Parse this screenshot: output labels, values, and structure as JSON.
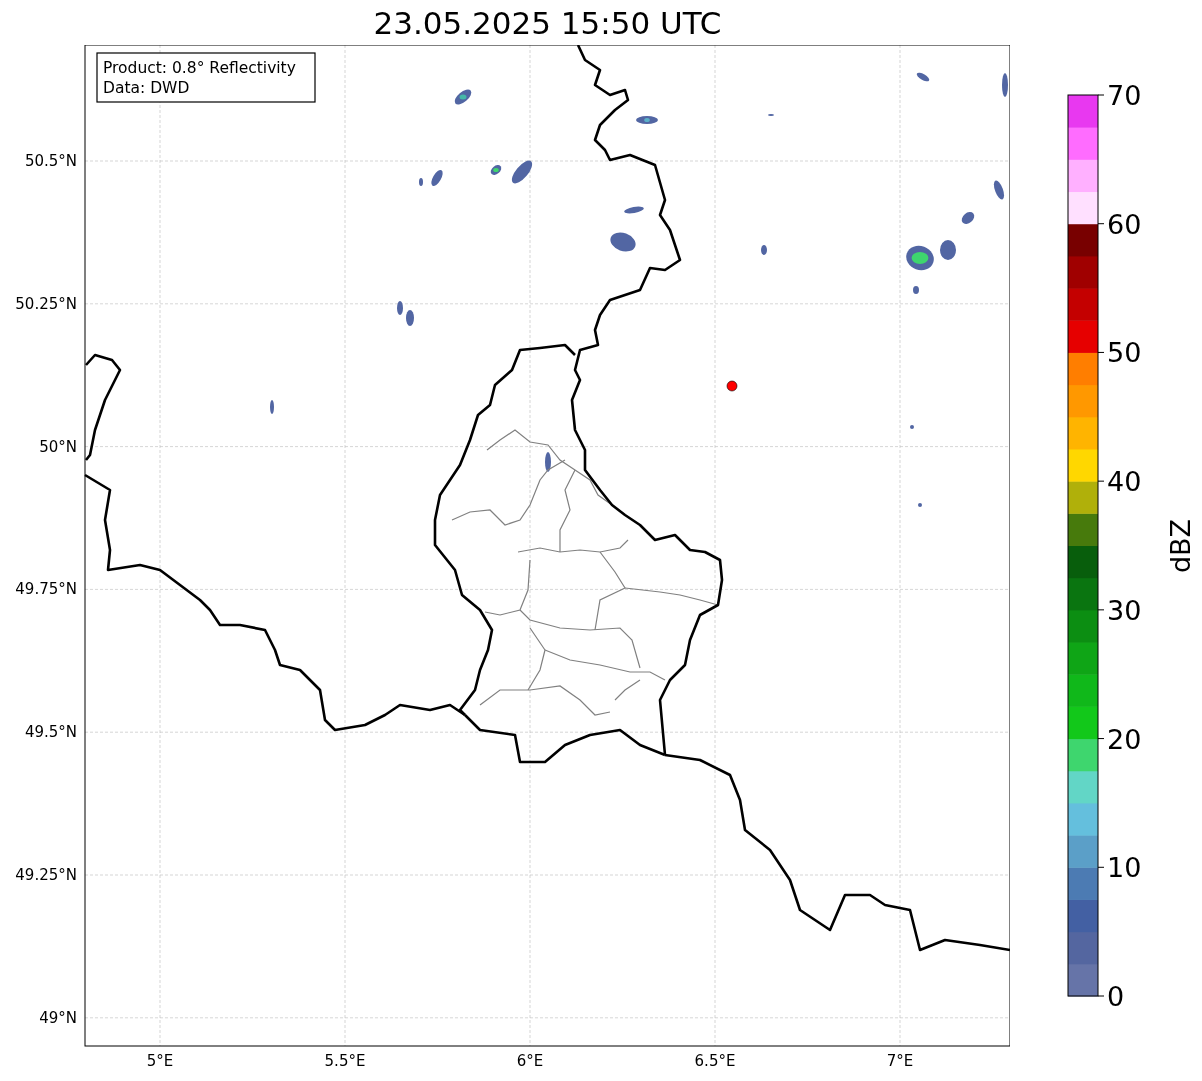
{
  "title": "23.05.2025 15:50 UTC",
  "info_box": [
    "Product: 0.8° Reflectivity",
    "Data: DWD"
  ],
  "map": {
    "x_ticks": [
      "5°E",
      "5.5°E",
      "6°E",
      "6.5°E",
      "7°E"
    ],
    "y_ticks": [
      "50.5°N",
      "50.25°N",
      "50°N",
      "49.75°N",
      "49.5°N",
      "49.25°N",
      "49°N"
    ]
  },
  "colorbar": {
    "label": "dBZ",
    "ticks": [
      "70",
      "60",
      "50",
      "40",
      "30",
      "20",
      "10",
      "0"
    ],
    "levels": [
      {
        "color": "#6674a8"
      },
      {
        "color": "#5466a0"
      },
      {
        "color": "#4360a3"
      },
      {
        "color": "#4c7bb3"
      },
      {
        "color": "#5b9fc8"
      },
      {
        "color": "#64bfdd"
      },
      {
        "color": "#62d6c6"
      },
      {
        "color": "#3ed66e"
      },
      {
        "color": "#12c81a"
      },
      {
        "color": "#10b81a"
      },
      {
        "color": "#0fa516"
      },
      {
        "color": "#0c8e12"
      },
      {
        "color": "#0a7510"
      },
      {
        "color": "#085e0c"
      },
      {
        "color": "#477a0c"
      },
      {
        "color": "#b0b00a"
      },
      {
        "color": "#ffd700"
      },
      {
        "color": "#ffb400"
      },
      {
        "color": "#ff9800"
      },
      {
        "color": "#ff7e00"
      },
      {
        "color": "#e60000"
      },
      {
        "color": "#c40000"
      },
      {
        "color": "#a00000"
      },
      {
        "color": "#780000"
      },
      {
        "color": "#ffe0ff"
      },
      {
        "color": "#ffb0ff"
      },
      {
        "color": "#ff6cff"
      },
      {
        "color": "#e838f0"
      }
    ]
  }
}
